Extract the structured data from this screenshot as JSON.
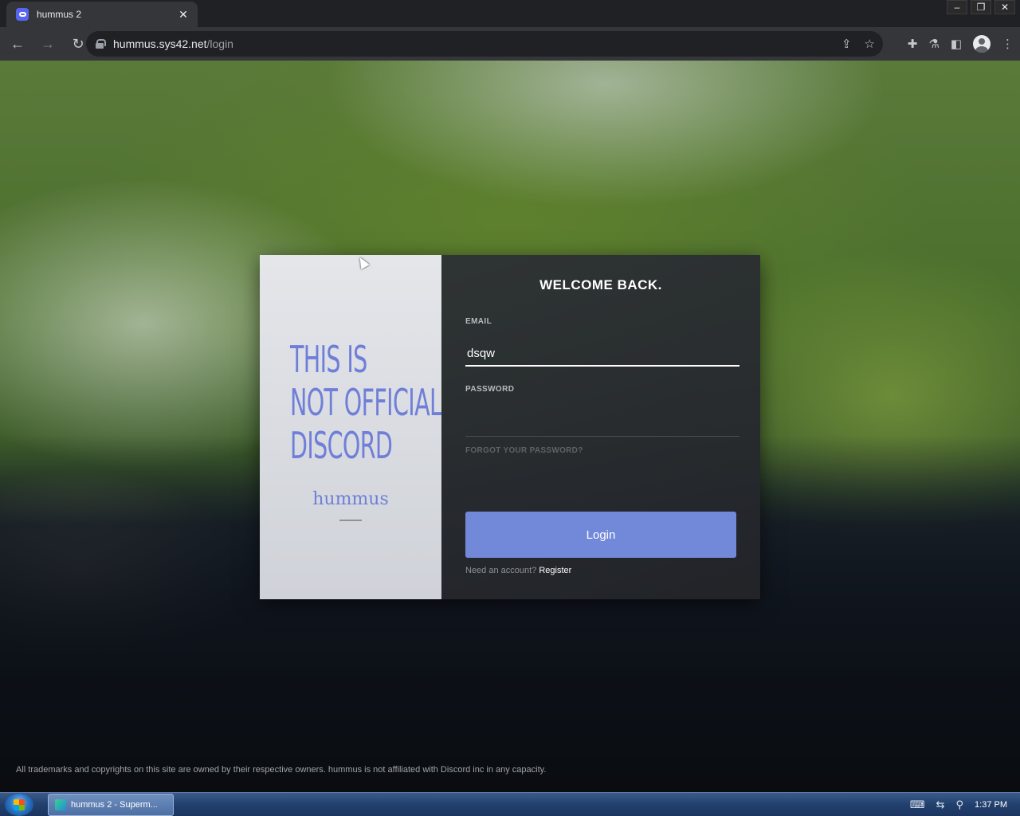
{
  "browser": {
    "tab_title": "hummus 2",
    "tab_close": "✕",
    "url_host": "hummus.sys42.net",
    "url_path": "/login",
    "window_controls": [
      "–",
      "❐",
      "✕"
    ]
  },
  "login": {
    "heading": "WELCOME BACK.",
    "email_label": "EMAIL",
    "email_value": "dsqw",
    "password_label": "PASSWORD",
    "password_value": "",
    "forgot_label": "FORGOT YOUR PASSWORD?",
    "login_button": "Login",
    "need_account": "Need an account? ",
    "register_link": "Register"
  },
  "notice": {
    "line1": "THIS IS",
    "line2": "NOT OFFICIAL",
    "line3": "DISCORD",
    "brand": "hummus"
  },
  "footer": {
    "text": "All trademarks and copyrights on this site are owned by their respective owners. hummus is not affiliated with Discord inc in any capacity."
  },
  "taskbar": {
    "window_label": "hummus 2 - Superm...",
    "clock": "1:37 PM"
  },
  "colors": {
    "accent": "#7289da",
    "notice_text": "#6f7fd8"
  }
}
